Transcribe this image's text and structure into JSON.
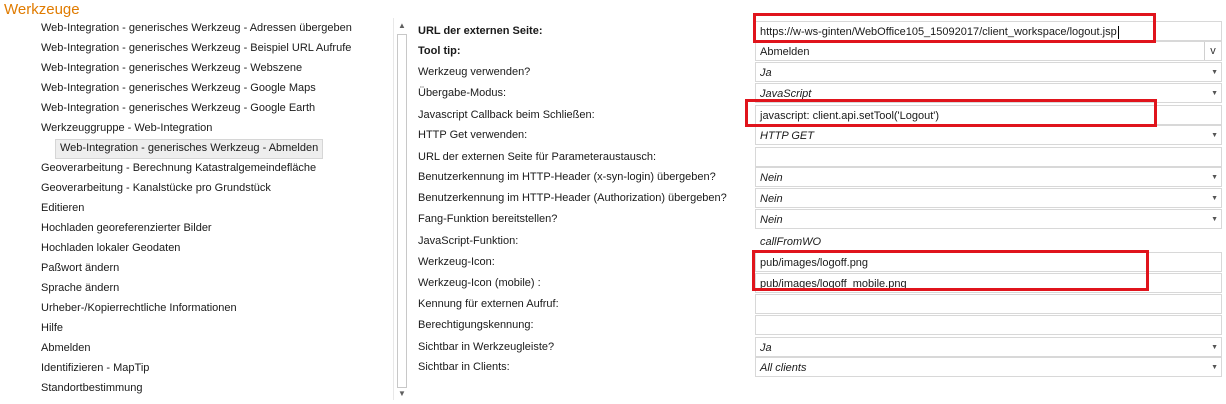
{
  "section_title": "Werkzeuge",
  "tree": {
    "items": [
      {
        "label": "Web-Integration - generisches Werkzeug - Adressen übergeben",
        "level": 0
      },
      {
        "label": "Web-Integration - generisches Werkzeug - Beispiel URL Aufrufe",
        "level": 0
      },
      {
        "label": "Web-Integration - generisches Werkzeug - Webszene",
        "level": 0
      },
      {
        "label": "Web-Integration - generisches Werkzeug - Google Maps",
        "level": 0
      },
      {
        "label": "Web-Integration - generisches Werkzeug - Google Earth",
        "level": 0
      },
      {
        "label": "Werkzeuggruppe - Web-Integration",
        "level": 0
      },
      {
        "label": "Web-Integration - generisches Werkzeug - Abmelden",
        "level": 1,
        "selected": true
      },
      {
        "label": "Geoverarbeitung - Berechnung Katastralgemeindefläche",
        "level": 0
      },
      {
        "label": "Geoverarbeitung - Kanalstücke pro Grundstück",
        "level": 0
      },
      {
        "label": "Editieren",
        "level": 0
      },
      {
        "label": "Hochladen georeferenzierter Bilder",
        "level": 0
      },
      {
        "label": "Hochladen lokaler Geodaten",
        "level": 0
      },
      {
        "label": "Paßwort ändern",
        "level": 0
      },
      {
        "label": "Sprache ändern",
        "level": 0
      },
      {
        "label": "Urheber-/Kopierrechtliche Informationen",
        "level": 0
      },
      {
        "label": "Hilfe",
        "level": 0
      },
      {
        "label": "Abmelden",
        "level": 0
      },
      {
        "label": "Identifizieren - MapTip",
        "level": 0
      },
      {
        "label": "Standortbestimmung",
        "level": 0
      }
    ]
  },
  "properties": [
    {
      "label": "URL der externen Seite:",
      "value": "https://w-ws-ginten/WebOffice105_15092017/client_workspace/logout.jsp",
      "bold": true,
      "type": "text",
      "caret": true
    },
    {
      "label": "Tool tip:",
      "value": "Abmelden",
      "bold": true,
      "type": "vbutton",
      "button_label": "v"
    },
    {
      "label": "Werkzeug verwenden?",
      "value": "Ja",
      "type": "dropdown",
      "italic": true
    },
    {
      "label": "Übergabe-Modus:",
      "value": "JavaScript",
      "type": "dropdown",
      "italic": true
    },
    {
      "label": "Javascript Callback beim Schließen:",
      "value": "javascript: client.api.setTool('Logout')",
      "type": "text"
    },
    {
      "label": "HTTP Get verwenden:",
      "value": "HTTP GET",
      "type": "dropdown",
      "italic": true
    },
    {
      "label": "URL der externen Seite für Parameteraustausch:",
      "value": "",
      "type": "text"
    },
    {
      "label": "Benutzerkennung im HTTP-Header (x-syn-login) übergeben?",
      "value": "Nein",
      "type": "dropdown",
      "italic": true
    },
    {
      "label": "Benutzerkennung im HTTP-Header (Authorization) übergeben?",
      "value": "Nein",
      "type": "dropdown",
      "italic": true
    },
    {
      "label": "Fang-Funktion bereitstellen?",
      "value": "Nein",
      "type": "dropdown",
      "italic": true
    },
    {
      "label": "JavaScript-Funktion:",
      "value": "callFromWO",
      "type": "placeholder",
      "italic": true
    },
    {
      "label": "Werkzeug-Icon:",
      "value": "pub/images/logoff.png",
      "type": "text"
    },
    {
      "label": "Werkzeug-Icon (mobile) :",
      "value": "pub/images/logoff_mobile.png",
      "type": "text"
    },
    {
      "label": "Kennung für externen Aufruf:",
      "value": "",
      "type": "text"
    },
    {
      "label": "Berechtigungskennung:",
      "value": "",
      "type": "text"
    },
    {
      "label": "Sichtbar in Werkzeugleiste?",
      "value": "Ja",
      "type": "dropdown",
      "italic": true
    },
    {
      "label": "Sichtbar in Clients:",
      "value": "All clients",
      "type": "dropdown",
      "italic": true
    }
  ],
  "icons": {
    "dropdown": "chevron-down-icon",
    "scroll_up": "scroll-up-arrow-icon",
    "scroll_down": "scroll-down-arrow-icon"
  },
  "colors": {
    "section_title": "#e07b00",
    "highlight": "#e0141c"
  }
}
